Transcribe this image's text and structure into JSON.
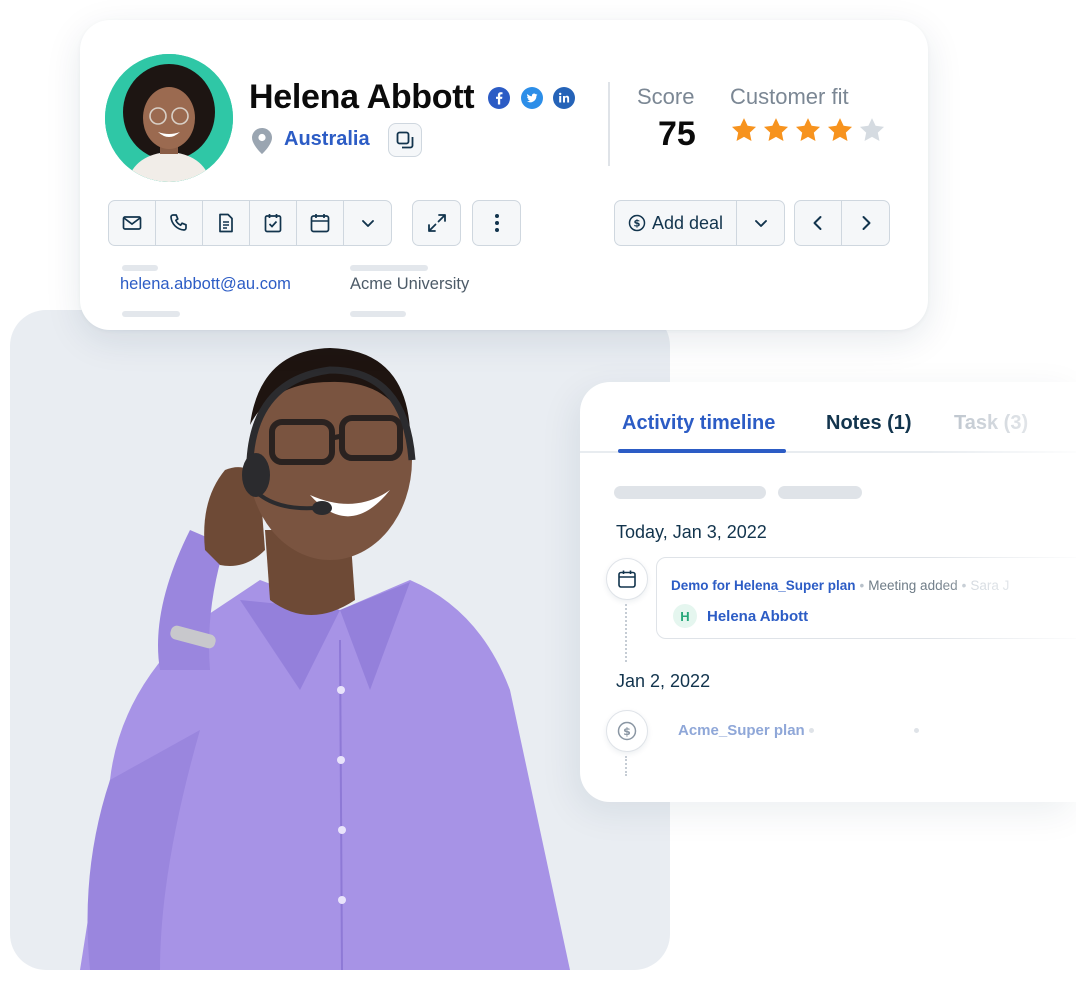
{
  "contact": {
    "name": "Helena Abbott",
    "location": "Australia",
    "email": "helena.abbott@au.com",
    "company": "Acme University",
    "social": [
      "facebook-icon",
      "twitter-icon",
      "linkedin-icon"
    ]
  },
  "score": {
    "label": "Score",
    "value": "75"
  },
  "customer_fit": {
    "label": "Customer fit",
    "rating": 4,
    "max": 5
  },
  "toolbar": {
    "comm_icons": [
      "email-icon",
      "phone-icon",
      "note-icon",
      "task-icon",
      "calendar-icon",
      "chevron-down-icon"
    ],
    "add_deal_label": "Add deal"
  },
  "activity": {
    "tabs": [
      {
        "label": "Activity timeline",
        "active": true
      },
      {
        "label": "Notes (1)",
        "active": false
      },
      {
        "label": "Task (3)",
        "active": false
      }
    ],
    "groups": [
      {
        "date": "Today, Jan 3, 2022",
        "event": {
          "title": "Demo for Helena_Super plan",
          "meta": "Meeting added",
          "user": "Sara J",
          "attendee_initial": "H",
          "attendee_name": "Helena Abbott"
        }
      },
      {
        "date": "Jan 2, 2022",
        "event": {
          "title": "Acme_Super plan"
        }
      }
    ]
  },
  "colors": {
    "accent": "#2c5cc5",
    "star_filled": "#f7931e",
    "star_empty": "#d5dbe1",
    "avatar_bg": "#2fc7a6"
  }
}
